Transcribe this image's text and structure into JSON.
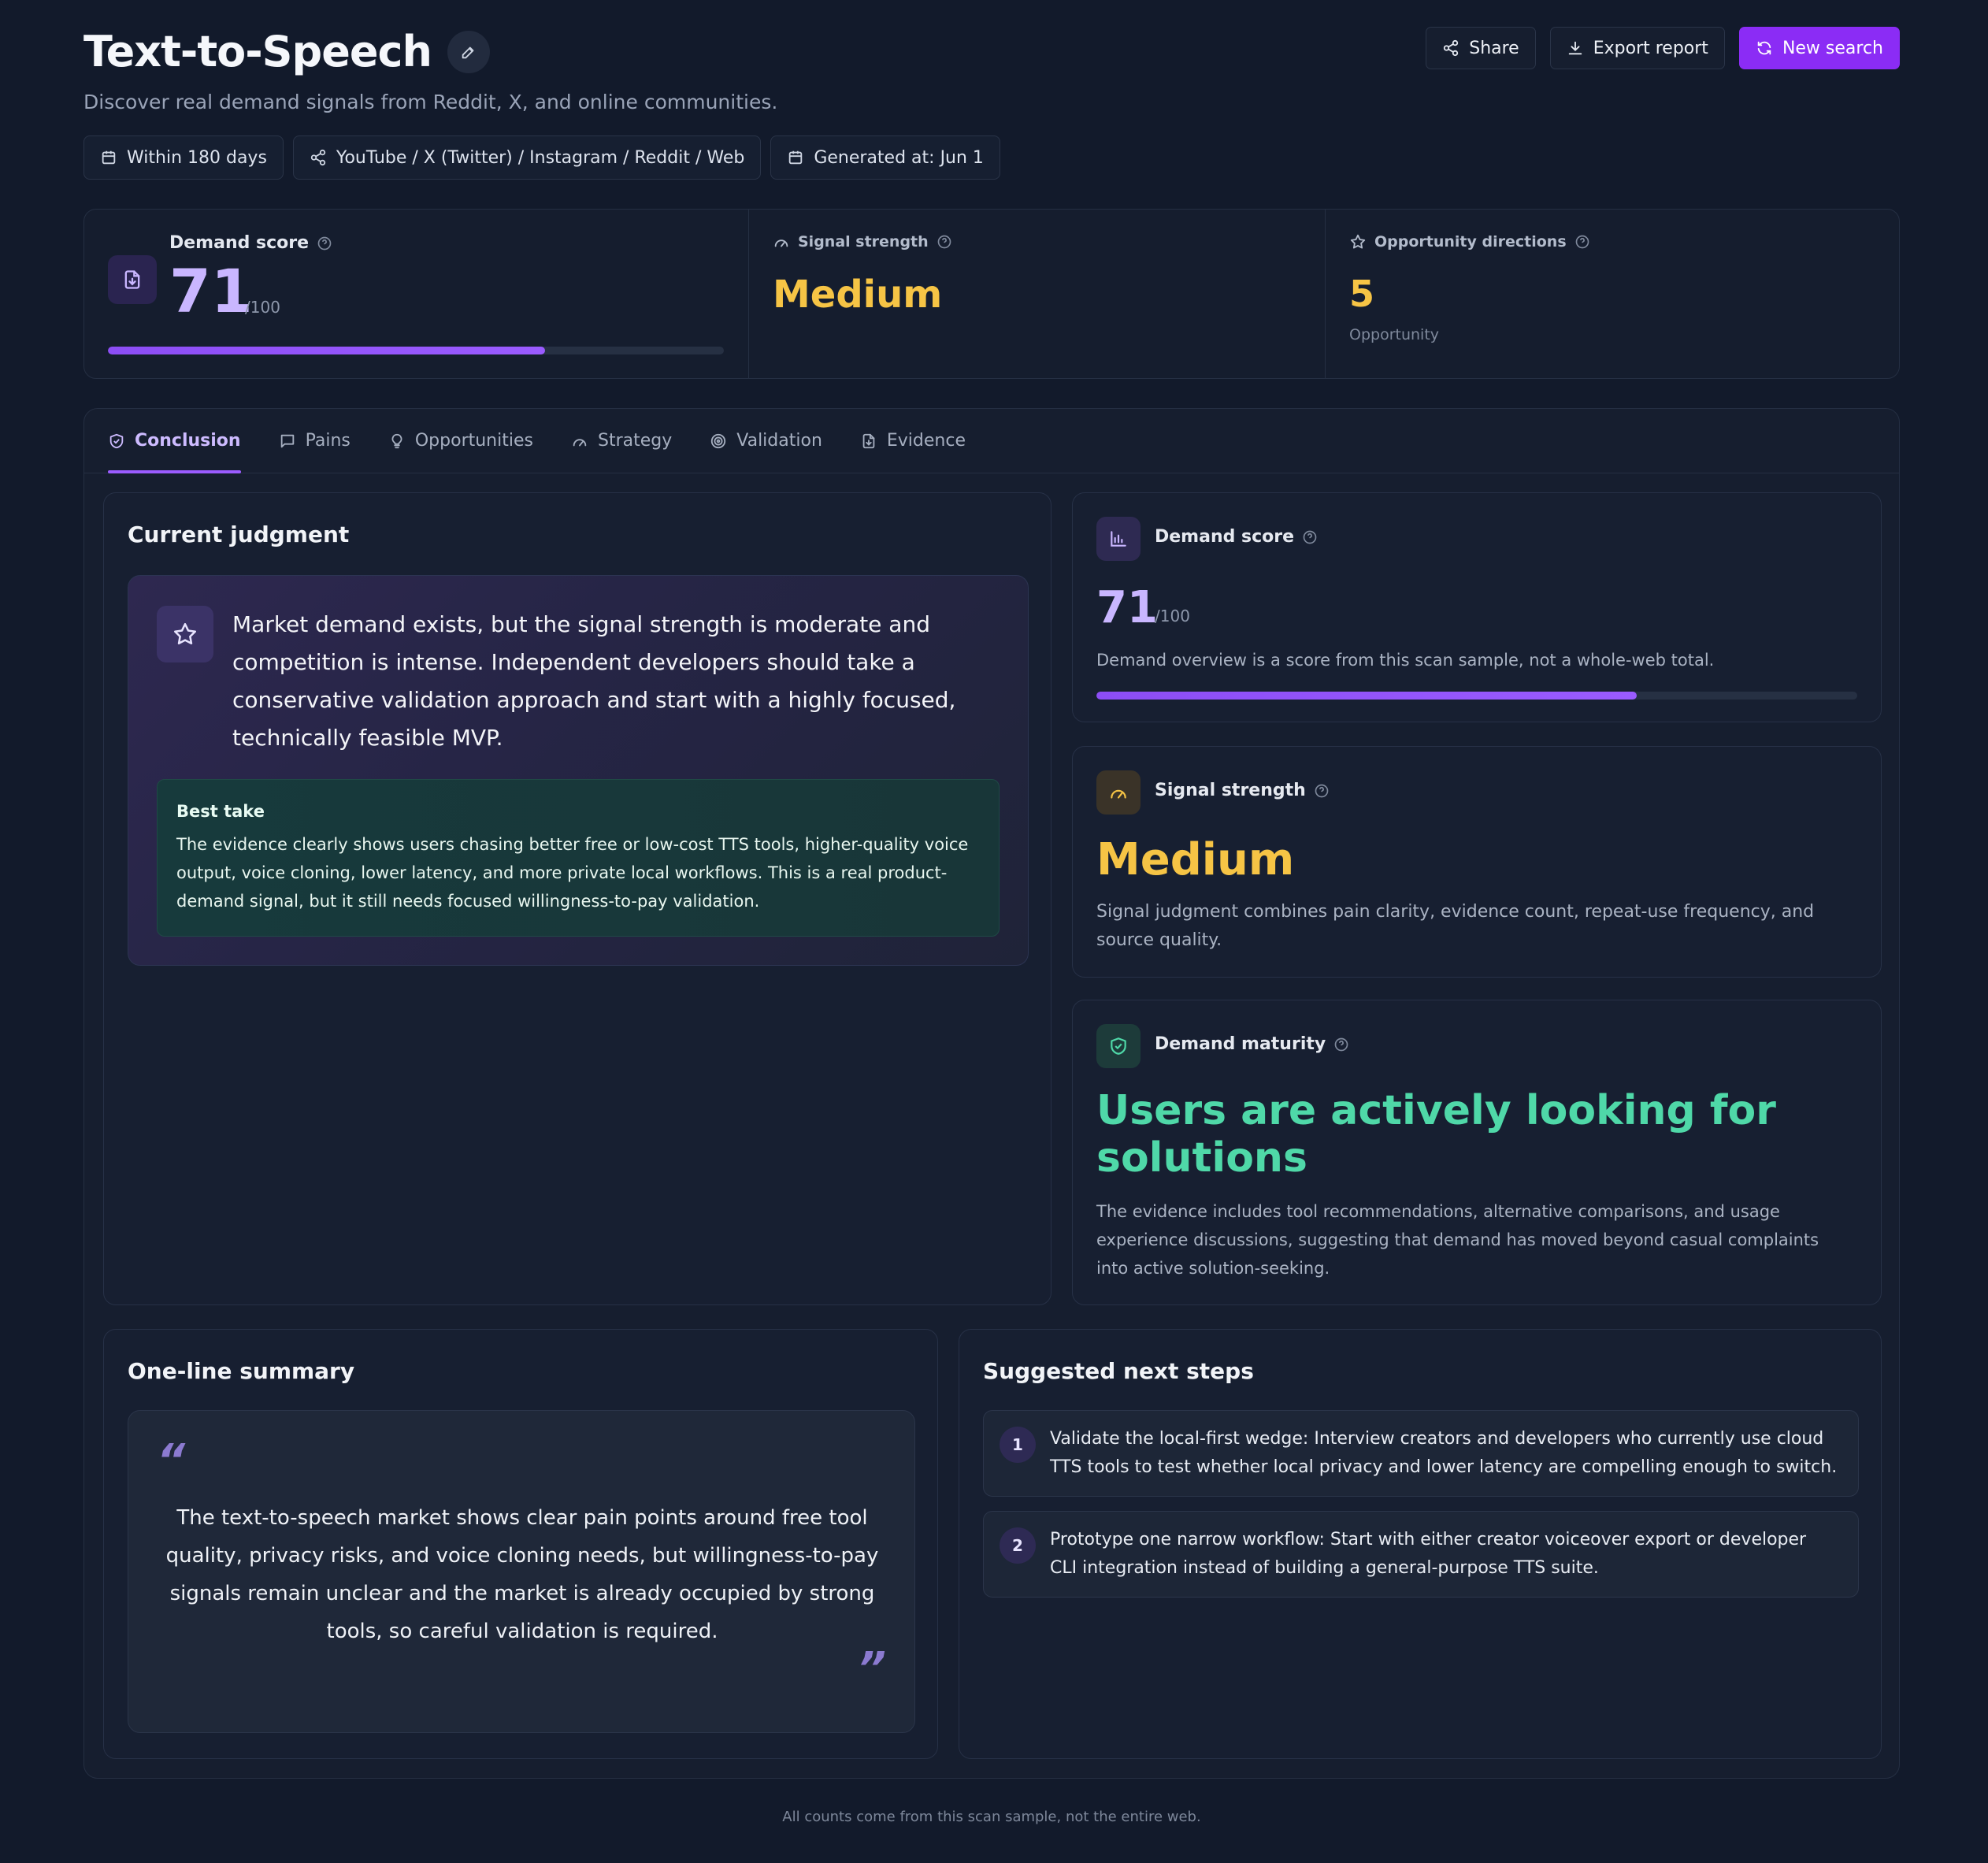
{
  "header": {
    "title": "Text-to-Speech",
    "subtitle": "Discover real demand signals from Reddit, X, and online communities.",
    "chips": {
      "range": "Within 180 days",
      "sources": "YouTube / X (Twitter) / Instagram / Reddit / Web",
      "generated": "Generated at: Jun 1"
    },
    "actions": {
      "share": "Share",
      "export": "Export report",
      "new_search": "New search"
    }
  },
  "metrics": {
    "demand_label": "Demand score",
    "demand_value": "71",
    "demand_max": "/100",
    "demand_fraction": 0.71,
    "signal_label": "Signal strength",
    "signal_value": "Medium",
    "opp_label": "Opportunity directions",
    "opp_value": "5",
    "opp_sub": "Opportunity"
  },
  "tabs": [
    {
      "label": "Conclusion"
    },
    {
      "label": "Pains"
    },
    {
      "label": "Opportunities"
    },
    {
      "label": "Strategy"
    },
    {
      "label": "Validation"
    },
    {
      "label": "Evidence"
    }
  ],
  "judgment": {
    "title": "Current judgment",
    "text": "Market demand exists, but the signal strength is moderate and competition is intense. Independent developers should take a conservative validation approach and start with a highly focused, technically feasible MVP.",
    "best_label": "Best take",
    "best_text": "The evidence clearly shows users chasing better free or low-cost TTS tools, higher-quality voice output, voice cloning, lower latency, and more private local workflows. This is a real product-demand signal, but it still needs focused willingness-to-pay validation."
  },
  "side": {
    "demand": {
      "label": "Demand score",
      "value": "71",
      "max": "/100",
      "fraction": 0.71,
      "desc": "Demand overview is a score from this scan sample, not a whole-web total."
    },
    "signal": {
      "label": "Signal strength",
      "value": "Medium",
      "desc": "Signal judgment combines pain clarity, evidence count, repeat-use frequency, and source quality."
    },
    "maturity": {
      "label": "Demand maturity",
      "value": "Users are actively looking for solutions",
      "desc": "The evidence includes tool recommendations, alternative comparisons, and usage experience discussions, suggesting that demand has moved beyond casual complaints into active solution-seeking."
    }
  },
  "summary": {
    "title": "One-line summary",
    "open_quote": "“",
    "close_quote": "”",
    "text": "The text-to-speech market shows clear pain points around free tool quality, privacy risks, and voice cloning needs, but willingness-to-pay signals remain unclear and the market is already occupied by strong tools, so careful validation is required."
  },
  "steps": {
    "title": "Suggested next steps",
    "items": [
      {
        "num": "1",
        "text": "Validate the local-first wedge: Interview creators and developers who currently use cloud TTS tools to test whether local privacy and lower latency are compelling enough to switch."
      },
      {
        "num": "2",
        "text": "Prototype one narrow workflow: Start with either creator voiceover export or developer CLI integration instead of building a general-purpose TTS suite."
      }
    ]
  },
  "footer": "All counts come from this scan sample, not the entire web.",
  "colors": {
    "accent": "#8b2cf5",
    "score": "#c9b6ff",
    "signal": "#f6c445",
    "maturity": "#4fd8a8"
  }
}
